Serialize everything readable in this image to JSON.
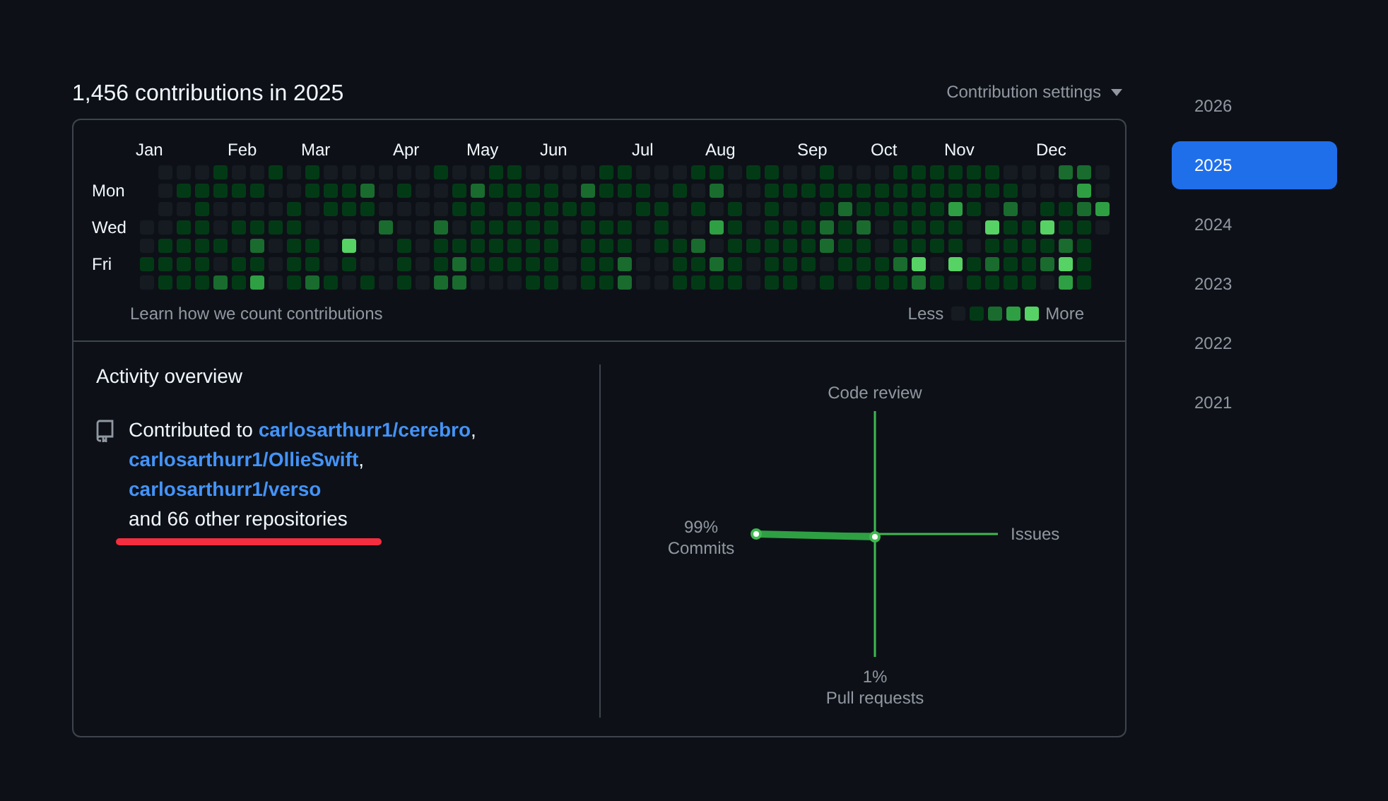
{
  "heading": "1,456 contributions in 2025",
  "settings": {
    "label": "Contribution settings"
  },
  "calendar": {
    "months": [
      "Jan",
      "Feb",
      "Mar",
      "Apr",
      "May",
      "Jun",
      "Jul",
      "Aug",
      "Sep",
      "Oct",
      "Nov",
      "Dec"
    ],
    "rows": [
      {
        "cells": [
          null,
          {
            "color": "#161b22"
          },
          {
            "color": "#161b22"
          },
          {
            "color": "#161b22"
          },
          {
            "color": "#033a16"
          },
          {
            "color": "#161b22"
          },
          {
            "color": "#161b22"
          },
          {
            "color": "#033a16"
          },
          {
            "color": "#161b22"
          },
          {
            "color": "#033a16"
          },
          {
            "color": "#161b22"
          },
          {
            "color": "#161b22"
          },
          {
            "color": "#161b22"
          },
          {
            "color": "#161b22"
          },
          {
            "color": "#161b22"
          },
          {
            "color": "#161b22"
          },
          {
            "color": "#033a16"
          },
          {
            "color": "#161b22"
          },
          {
            "color": "#161b22"
          },
          {
            "color": "#033a16"
          },
          {
            "color": "#033a16"
          },
          {
            "color": "#161b22"
          },
          {
            "color": "#161b22"
          },
          {
            "color": "#161b22"
          },
          {
            "color": "#161b22"
          },
          {
            "color": "#033a16"
          },
          {
            "color": "#033a16"
          },
          {
            "color": "#161b22"
          },
          {
            "color": "#161b22"
          },
          {
            "color": "#161b22"
          },
          {
            "color": "#033a16"
          },
          {
            "color": "#033a16"
          },
          {
            "color": "#161b22"
          },
          {
            "color": "#033a16"
          },
          {
            "color": "#033a16"
          },
          {
            "color": "#161b22"
          },
          {
            "color": "#161b22"
          },
          {
            "color": "#033a16"
          },
          {
            "color": "#161b22"
          },
          {
            "color": "#161b22"
          },
          {
            "color": "#161b22"
          },
          {
            "color": "#033a16"
          },
          {
            "color": "#033a16"
          },
          {
            "color": "#033a16"
          },
          {
            "color": "#033a16"
          },
          {
            "color": "#033a16"
          },
          {
            "color": "#033a16"
          },
          {
            "color": "#161b22"
          },
          {
            "color": "#161b22"
          },
          {
            "color": "#161b22"
          },
          {
            "color": "#196c2e"
          },
          {
            "color": "#196c2e"
          },
          {
            "color": "#161b22"
          }
        ]
      },
      {
        "label": "Mon",
        "cells": [
          null,
          {
            "color": "#161b22"
          },
          {
            "color": "#033a16"
          },
          {
            "color": "#033a16"
          },
          {
            "color": "#033a16"
          },
          {
            "color": "#033a16"
          },
          {
            "color": "#033a16"
          },
          {
            "color": "#161b22"
          },
          {
            "color": "#161b22"
          },
          {
            "color": "#033a16"
          },
          {
            "color": "#033a16"
          },
          {
            "color": "#033a16"
          },
          {
            "color": "#196c2e"
          },
          {
            "color": "#161b22"
          },
          {
            "color": "#033a16"
          },
          {
            "color": "#161b22"
          },
          {
            "color": "#161b22"
          },
          {
            "color": "#033a16"
          },
          {
            "color": "#196c2e"
          },
          {
            "color": "#033a16"
          },
          {
            "color": "#033a16"
          },
          {
            "color": "#033a16"
          },
          {
            "color": "#033a16"
          },
          {
            "color": "#161b22"
          },
          {
            "color": "#196c2e"
          },
          {
            "color": "#033a16"
          },
          {
            "color": "#033a16"
          },
          {
            "color": "#033a16"
          },
          {
            "color": "#161b22"
          },
          {
            "color": "#033a16"
          },
          {
            "color": "#161b22"
          },
          {
            "color": "#196c2e"
          },
          {
            "color": "#161b22"
          },
          {
            "color": "#161b22"
          },
          {
            "color": "#033a16"
          },
          {
            "color": "#033a16"
          },
          {
            "color": "#033a16"
          },
          {
            "color": "#033a16"
          },
          {
            "color": "#033a16"
          },
          {
            "color": "#033a16"
          },
          {
            "color": "#033a16"
          },
          {
            "color": "#033a16"
          },
          {
            "color": "#033a16"
          },
          {
            "color": "#033a16"
          },
          {
            "color": "#033a16"
          },
          {
            "color": "#033a16"
          },
          {
            "color": "#033a16"
          },
          {
            "color": "#033a16"
          },
          {
            "color": "#161b22"
          },
          {
            "color": "#161b22"
          },
          {
            "color": "#161b22"
          },
          {
            "color": "#2ea043"
          },
          {
            "color": "#161b22"
          }
        ]
      },
      {
        "cells": [
          null,
          {
            "color": "#161b22"
          },
          {
            "color": "#161b22"
          },
          {
            "color": "#033a16"
          },
          {
            "color": "#161b22"
          },
          {
            "color": "#161b22"
          },
          {
            "color": "#161b22"
          },
          {
            "color": "#161b22"
          },
          {
            "color": "#033a16"
          },
          {
            "color": "#161b22"
          },
          {
            "color": "#033a16"
          },
          {
            "color": "#033a16"
          },
          {
            "color": "#033a16"
          },
          {
            "color": "#161b22"
          },
          {
            "color": "#161b22"
          },
          {
            "color": "#161b22"
          },
          {
            "color": "#161b22"
          },
          {
            "color": "#033a16"
          },
          {
            "color": "#033a16"
          },
          {
            "color": "#161b22"
          },
          {
            "color": "#033a16"
          },
          {
            "color": "#033a16"
          },
          {
            "color": "#033a16"
          },
          {
            "color": "#033a16"
          },
          {
            "color": "#033a16"
          },
          {
            "color": "#161b22"
          },
          {
            "color": "#161b22"
          },
          {
            "color": "#033a16"
          },
          {
            "color": "#033a16"
          },
          {
            "color": "#161b22"
          },
          {
            "color": "#033a16"
          },
          {
            "color": "#161b22"
          },
          {
            "color": "#033a16"
          },
          {
            "color": "#161b22"
          },
          {
            "color": "#033a16"
          },
          {
            "color": "#161b22"
          },
          {
            "color": "#161b22"
          },
          {
            "color": "#033a16"
          },
          {
            "color": "#196c2e"
          },
          {
            "color": "#033a16"
          },
          {
            "color": "#033a16"
          },
          {
            "color": "#033a16"
          },
          {
            "color": "#033a16"
          },
          {
            "color": "#033a16"
          },
          {
            "color": "#2ea043"
          },
          {
            "color": "#033a16"
          },
          {
            "color": "#161b22"
          },
          {
            "color": "#196c2e"
          },
          {
            "color": "#161b22"
          },
          {
            "color": "#033a16"
          },
          {
            "color": "#033a16"
          },
          {
            "color": "#196c2e"
          },
          {
            "color": "#2ea043"
          }
        ]
      },
      {
        "label": "Wed",
        "cells": [
          {
            "color": "#161b22"
          },
          {
            "color": "#161b22"
          },
          {
            "color": "#033a16"
          },
          {
            "color": "#033a16"
          },
          {
            "color": "#161b22"
          },
          {
            "color": "#033a16"
          },
          {
            "color": "#033a16"
          },
          {
            "color": "#033a16"
          },
          {
            "color": "#033a16"
          },
          {
            "color": "#161b22"
          },
          {
            "color": "#161b22"
          },
          {
            "color": "#161b22"
          },
          {
            "color": "#161b22"
          },
          {
            "color": "#196c2e"
          },
          {
            "color": "#161b22"
          },
          {
            "color": "#161b22"
          },
          {
            "color": "#196c2e"
          },
          {
            "color": "#161b22"
          },
          {
            "color": "#033a16"
          },
          {
            "color": "#033a16"
          },
          {
            "color": "#033a16"
          },
          {
            "color": "#033a16"
          },
          {
            "color": "#033a16"
          },
          {
            "color": "#161b22"
          },
          {
            "color": "#033a16"
          },
          {
            "color": "#033a16"
          },
          {
            "color": "#033a16"
          },
          {
            "color": "#161b22"
          },
          {
            "color": "#033a16"
          },
          {
            "color": "#161b22"
          },
          {
            "color": "#161b22"
          },
          {
            "color": "#2ea043"
          },
          {
            "color": "#033a16"
          },
          {
            "color": "#161b22"
          },
          {
            "color": "#033a16"
          },
          {
            "color": "#033a16"
          },
          {
            "color": "#033a16"
          },
          {
            "color": "#196c2e"
          },
          {
            "color": "#033a16"
          },
          {
            "color": "#196c2e"
          },
          {
            "color": "#161b22"
          },
          {
            "color": "#033a16"
          },
          {
            "color": "#033a16"
          },
          {
            "color": "#033a16"
          },
          {
            "color": "#033a16"
          },
          {
            "color": "#161b22"
          },
          {
            "color": "#56d364"
          },
          {
            "color": "#033a16"
          },
          {
            "color": "#033a16"
          },
          {
            "color": "#56d364"
          },
          {
            "color": "#033a16"
          },
          {
            "color": "#033a16"
          },
          {
            "color": "#161b22"
          }
        ]
      },
      {
        "cells": [
          {
            "color": "#161b22"
          },
          {
            "color": "#033a16"
          },
          {
            "color": "#033a16"
          },
          {
            "color": "#033a16"
          },
          {
            "color": "#033a16"
          },
          {
            "color": "#161b22"
          },
          {
            "color": "#196c2e"
          },
          {
            "color": "#161b22"
          },
          {
            "color": "#033a16"
          },
          {
            "color": "#033a16"
          },
          {
            "color": "#161b22"
          },
          {
            "color": "#56d364"
          },
          {
            "color": "#161b22"
          },
          {
            "color": "#161b22"
          },
          {
            "color": "#033a16"
          },
          {
            "color": "#161b22"
          },
          {
            "color": "#033a16"
          },
          {
            "color": "#033a16"
          },
          {
            "color": "#033a16"
          },
          {
            "color": "#033a16"
          },
          {
            "color": "#033a16"
          },
          {
            "color": "#033a16"
          },
          {
            "color": "#033a16"
          },
          {
            "color": "#161b22"
          },
          {
            "color": "#033a16"
          },
          {
            "color": "#033a16"
          },
          {
            "color": "#033a16"
          },
          {
            "color": "#161b22"
          },
          {
            "color": "#033a16"
          },
          {
            "color": "#033a16"
          },
          {
            "color": "#196c2e"
          },
          {
            "color": "#161b22"
          },
          {
            "color": "#033a16"
          },
          {
            "color": "#033a16"
          },
          {
            "color": "#033a16"
          },
          {
            "color": "#033a16"
          },
          {
            "color": "#033a16"
          },
          {
            "color": "#196c2e"
          },
          {
            "color": "#033a16"
          },
          {
            "color": "#033a16"
          },
          {
            "color": "#161b22"
          },
          {
            "color": "#033a16"
          },
          {
            "color": "#033a16"
          },
          {
            "color": "#033a16"
          },
          {
            "color": "#033a16"
          },
          {
            "color": "#161b22"
          },
          {
            "color": "#033a16"
          },
          {
            "color": "#033a16"
          },
          {
            "color": "#033a16"
          },
          {
            "color": "#033a16"
          },
          {
            "color": "#196c2e"
          },
          {
            "color": "#033a16"
          },
          null
        ]
      },
      {
        "label": "Fri",
        "cells": [
          {
            "color": "#033a16"
          },
          {
            "color": "#033a16"
          },
          {
            "color": "#033a16"
          },
          {
            "color": "#033a16"
          },
          {
            "color": "#161b22"
          },
          {
            "color": "#033a16"
          },
          {
            "color": "#033a16"
          },
          {
            "color": "#161b22"
          },
          {
            "color": "#033a16"
          },
          {
            "color": "#033a16"
          },
          {
            "color": "#161b22"
          },
          {
            "color": "#033a16"
          },
          {
            "color": "#161b22"
          },
          {
            "color": "#161b22"
          },
          {
            "color": "#033a16"
          },
          {
            "color": "#161b22"
          },
          {
            "color": "#033a16"
          },
          {
            "color": "#196c2e"
          },
          {
            "color": "#033a16"
          },
          {
            "color": "#033a16"
          },
          {
            "color": "#033a16"
          },
          {
            "color": "#033a16"
          },
          {
            "color": "#033a16"
          },
          {
            "color": "#161b22"
          },
          {
            "color": "#033a16"
          },
          {
            "color": "#033a16"
          },
          {
            "color": "#196c2e"
          },
          {
            "color": "#161b22"
          },
          {
            "color": "#161b22"
          },
          {
            "color": "#033a16"
          },
          {
            "color": "#033a16"
          },
          {
            "color": "#196c2e"
          },
          {
            "color": "#033a16"
          },
          {
            "color": "#161b22"
          },
          {
            "color": "#033a16"
          },
          {
            "color": "#033a16"
          },
          {
            "color": "#033a16"
          },
          {
            "color": "#161b22"
          },
          {
            "color": "#033a16"
          },
          {
            "color": "#033a16"
          },
          {
            "color": "#033a16"
          },
          {
            "color": "#196c2e"
          },
          {
            "color": "#56d364"
          },
          {
            "color": "#161b22"
          },
          {
            "color": "#56d364"
          },
          {
            "color": "#033a16"
          },
          {
            "color": "#196c2e"
          },
          {
            "color": "#033a16"
          },
          {
            "color": "#033a16"
          },
          {
            "color": "#196c2e"
          },
          {
            "color": "#56d364"
          },
          {
            "color": "#033a16"
          },
          null
        ]
      },
      {
        "cells": [
          {
            "color": "#161b22"
          },
          {
            "color": "#033a16"
          },
          {
            "color": "#033a16"
          },
          {
            "color": "#033a16"
          },
          {
            "color": "#196c2e"
          },
          {
            "color": "#033a16"
          },
          {
            "color": "#2ea043"
          },
          {
            "color": "#161b22"
          },
          {
            "color": "#033a16"
          },
          {
            "color": "#196c2e"
          },
          {
            "color": "#033a16"
          },
          {
            "color": "#161b22"
          },
          {
            "color": "#033a16"
          },
          {
            "color": "#161b22"
          },
          {
            "color": "#033a16"
          },
          {
            "color": "#161b22"
          },
          {
            "color": "#196c2e"
          },
          {
            "color": "#196c2e"
          },
          {
            "color": "#161b22"
          },
          {
            "color": "#161b22"
          },
          {
            "color": "#161b22"
          },
          {
            "color": "#033a16"
          },
          {
            "color": "#033a16"
          },
          {
            "color": "#161b22"
          },
          {
            "color": "#033a16"
          },
          {
            "color": "#033a16"
          },
          {
            "color": "#196c2e"
          },
          {
            "color": "#161b22"
          },
          {
            "color": "#161b22"
          },
          {
            "color": "#033a16"
          },
          {
            "color": "#033a16"
          },
          {
            "color": "#033a16"
          },
          {
            "color": "#033a16"
          },
          {
            "color": "#161b22"
          },
          {
            "color": "#033a16"
          },
          {
            "color": "#033a16"
          },
          {
            "color": "#161b22"
          },
          {
            "color": "#033a16"
          },
          {
            "color": "#161b22"
          },
          {
            "color": "#033a16"
          },
          {
            "color": "#033a16"
          },
          {
            "color": "#033a16"
          },
          {
            "color": "#196c2e"
          },
          {
            "color": "#033a16"
          },
          {
            "color": "#161b22"
          },
          {
            "color": "#033a16"
          },
          {
            "color": "#033a16"
          },
          {
            "color": "#033a16"
          },
          {
            "color": "#033a16"
          },
          {
            "color": "#161b22"
          },
          {
            "color": "#2ea043"
          },
          {
            "color": "#033a16"
          },
          null
        ]
      }
    ],
    "learn_link": "Learn how we count contributions",
    "legend": {
      "less": "Less",
      "more": "More",
      "cells": [
        {
          "color": "#161b22"
        },
        {
          "color": "#033a16"
        },
        {
          "color": "#196c2e"
        },
        {
          "color": "#2ea043"
        },
        {
          "color": "#56d364"
        }
      ]
    }
  },
  "activity": {
    "title": "Activity overview",
    "contributed_prefix": "Contributed to",
    "repos": [
      {
        "name": "carlosarthurr1/cerebro",
        "separator": ","
      },
      {
        "name": "carlosarthurr1/OllieSwift",
        "separator": ","
      },
      {
        "name": "carlosarthurr1/verso"
      }
    ],
    "others": "and 66 other repositories",
    "axes": [
      {
        "kind": "top",
        "label": "Code review"
      },
      {
        "kind": "right",
        "label": "Issues"
      },
      {
        "kind": "bottom",
        "label": "Pull requests",
        "value": "1%"
      },
      {
        "kind": "left",
        "label": "Commits",
        "value": "99%"
      }
    ]
  },
  "years": [
    {
      "label": "2026",
      "selected": false
    },
    {
      "label": "2025",
      "selected": true
    },
    {
      "label": "2024",
      "selected": false
    },
    {
      "label": "2023",
      "selected": false
    },
    {
      "label": "2022",
      "selected": false
    },
    {
      "label": "2021",
      "selected": false
    }
  ]
}
